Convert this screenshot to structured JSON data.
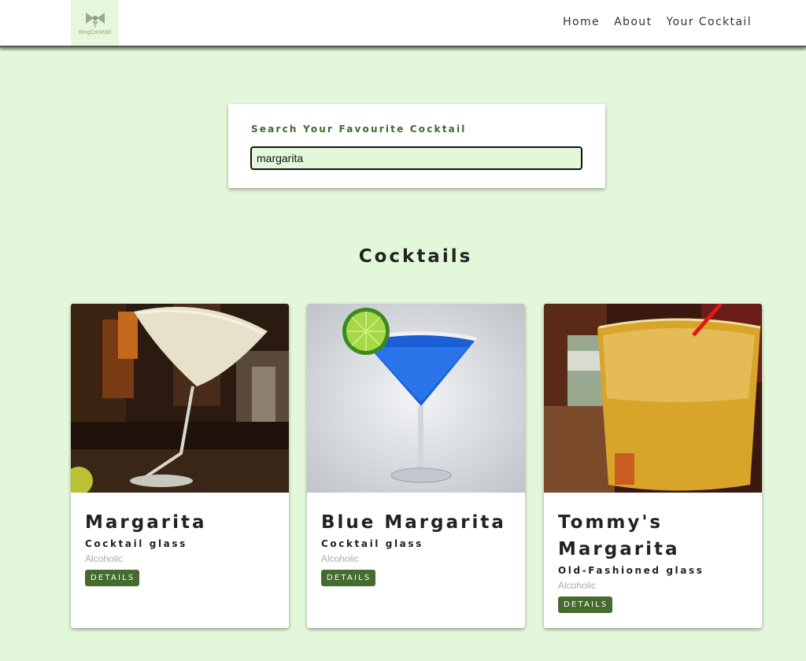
{
  "header": {
    "logo_text": "KingCocktail",
    "nav": [
      {
        "label": "Home"
      },
      {
        "label": "About"
      },
      {
        "label": "Your Cocktail"
      }
    ]
  },
  "search": {
    "label": "Search Your Favourite Cocktail",
    "value": "margarita"
  },
  "main": {
    "title": "Cocktails",
    "cocktails": [
      {
        "name": "Margarita",
        "glass": "Cocktail glass",
        "type": "Alcoholic",
        "button": "DETAILS",
        "image": "margarita-photo"
      },
      {
        "name": "Blue Margarita",
        "glass": "Cocktail glass",
        "type": "Alcoholic",
        "button": "DETAILS",
        "image": "blue-margarita-photo"
      },
      {
        "name": "Tommy's Margarita",
        "glass": "Old-Fashioned glass",
        "type": "Alcoholic",
        "button": "DETAILS",
        "image": "tommys-margarita-photo"
      }
    ]
  },
  "colors": {
    "background": "#e3f8da",
    "accent": "#456b2f",
    "label_green": "#3e6a2a"
  }
}
